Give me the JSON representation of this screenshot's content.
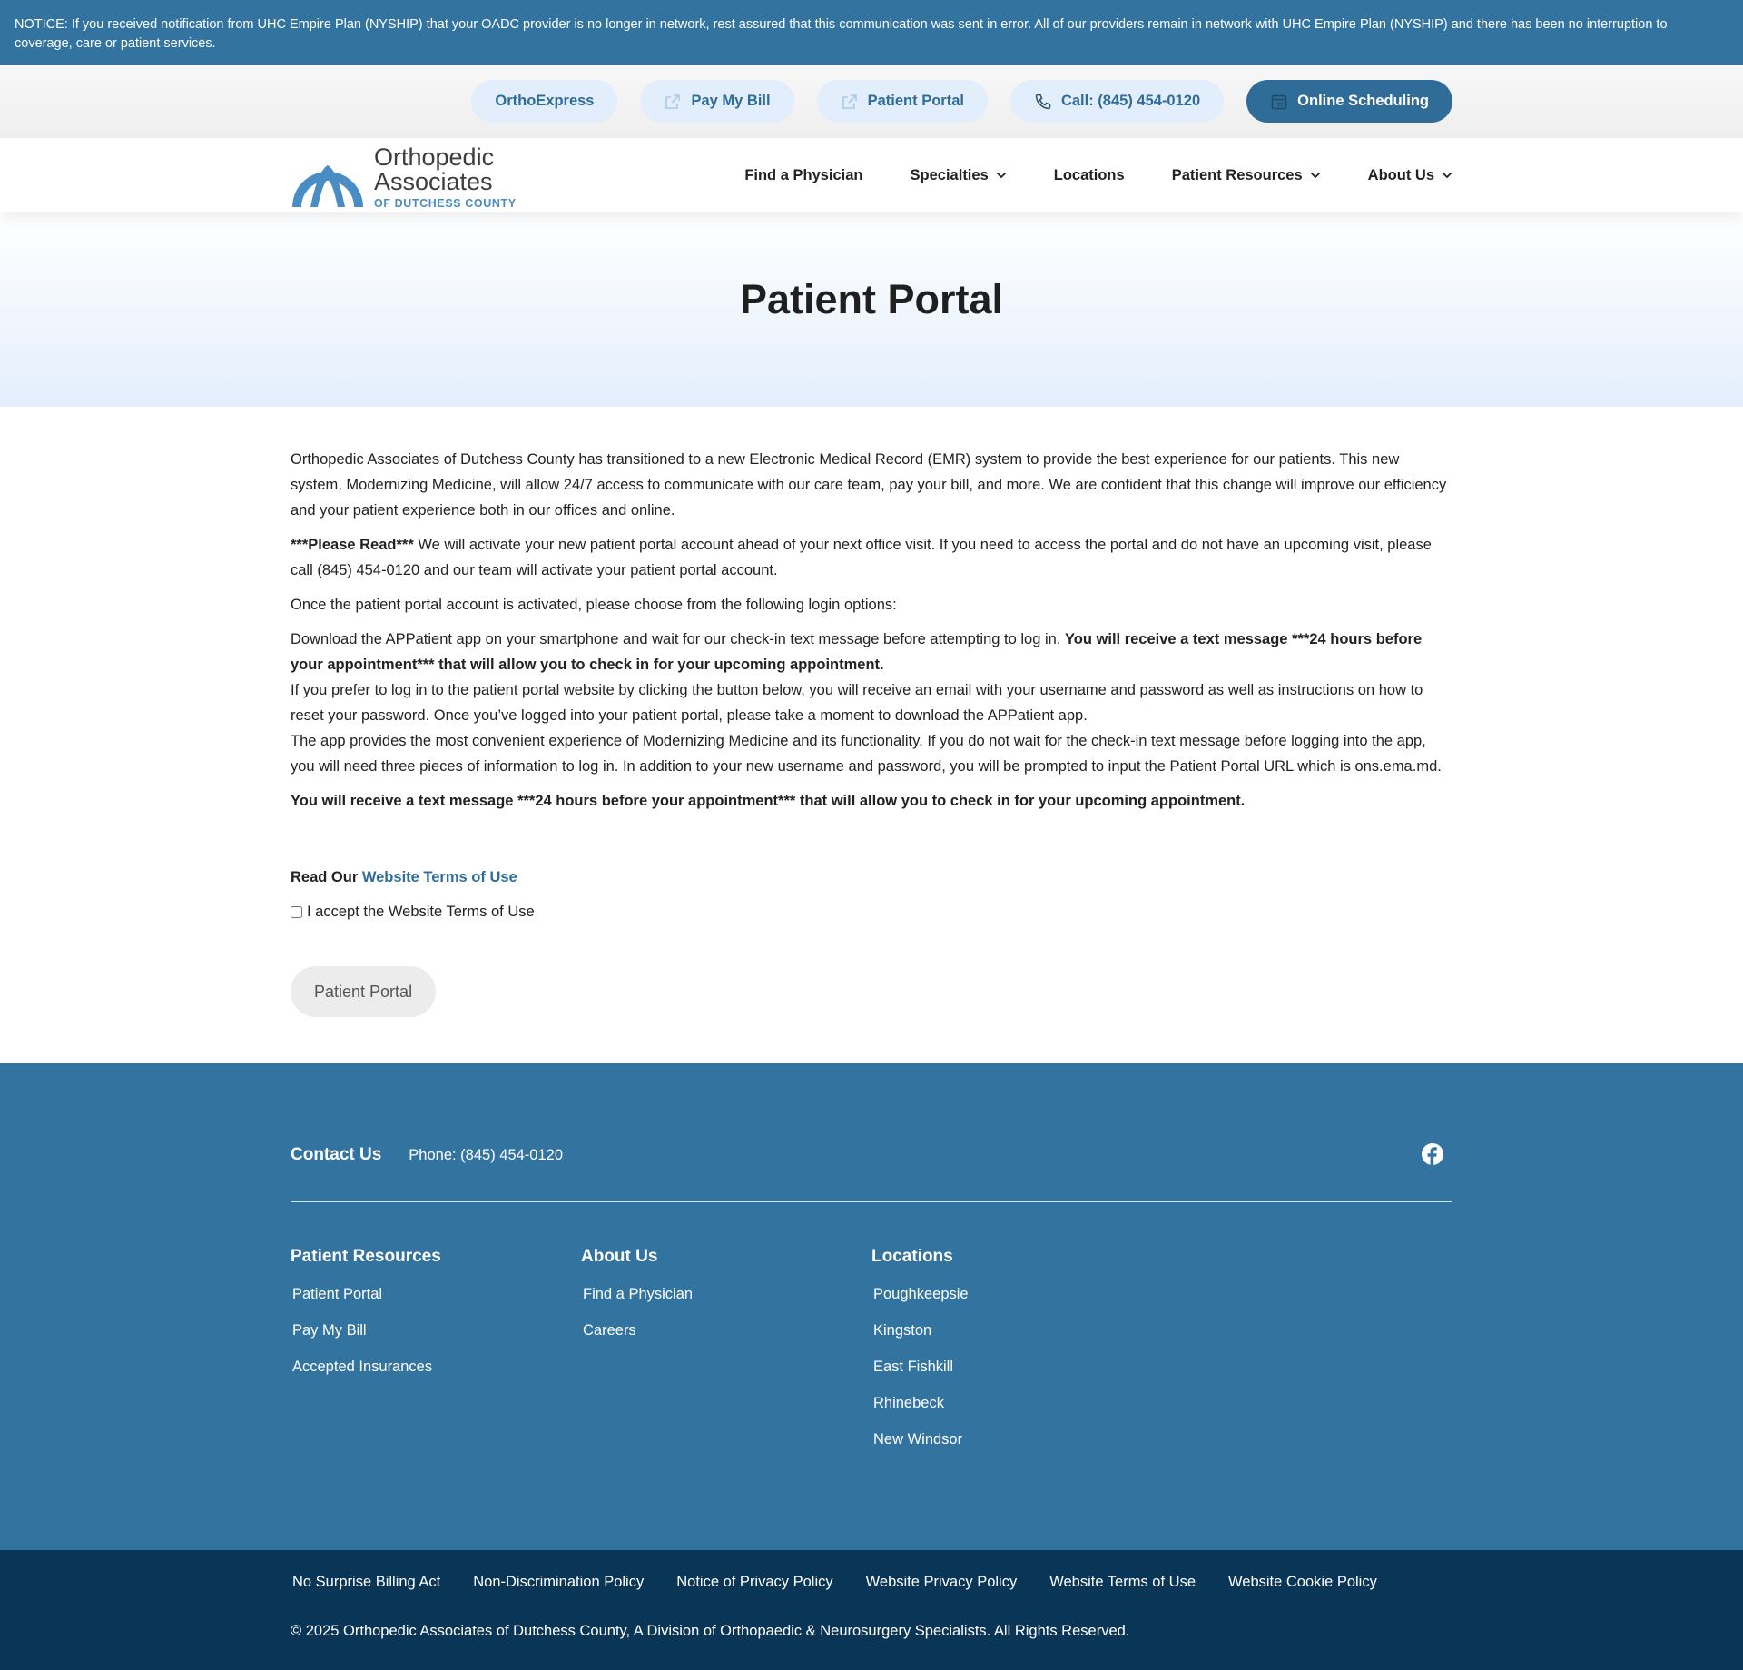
{
  "notice": "NOTICE: If you received notification from UHC Empire Plan (NYSHIP) that your OADC provider is no longer in network, rest assured that this communication was sent in error. All of our providers remain in network with UHC Empire Plan (NYSHIP) and there has been no interruption to coverage, care or patient services.",
  "utility": {
    "orthoexpress": "OrthoExpress",
    "pay_bill": "Pay My Bill",
    "patient_portal": "Patient Portal",
    "call": "Call: (845) 454-0120",
    "online_scheduling": "Online Scheduling"
  },
  "logo": {
    "line1": "Orthopedic",
    "line2": "Associates",
    "sub": "OF DUTCHESS COUNTY"
  },
  "nav": {
    "find_physician": "Find a Physician",
    "specialties": "Specialties",
    "locations": "Locations",
    "patient_resources": "Patient Resources",
    "about_us": "About Us"
  },
  "hero": {
    "title": "Patient Portal"
  },
  "content": {
    "p1": "Orthopedic Associates of Dutchess County has transitioned to a new Electronic Medical Record (EMR) system to provide the best experience for our patients. This new system, Modernizing Medicine, will allow 24/7 access to communicate with our care team, pay your bill, and more. We are confident that this change will improve our efficiency and your patient experience both in our offices and online.",
    "p2_bold": "***Please Read***",
    "p2_rest": " We will activate your new patient portal account ahead of your next office visit. If you need to access the portal and do not have an upcoming visit, please call (845) 454-0120 and our team will activate your patient portal account.",
    "p3": "Once the patient portal account is activated, please choose from the following login options:",
    "p4_plain": "Download the APPatient app on your smartphone and wait for our check-in text message before attempting to log in. ",
    "p4_bold": "You will receive a text message ***24 hours before your appointment*** that will allow you to check in for your upcoming appointment.",
    "p5": "If you prefer to log in to the patient portal website by clicking the button below, you will receive an email with your username and password as well as instructions on how to reset your password. Once you’ve logged into your patient portal, please take a moment to download the APPatient app.",
    "p6": "The app provides the most convenient experience of Modernizing Medicine and its functionality. If you do not wait for the check-in text message before logging into the app, you will need three pieces of information to log in. In addition to your new username and password, you will be prompted to input the Patient Portal URL which is ons.ema.md.",
    "p7": "You will receive a text message ***24 hours before your appointment*** that will allow you to check in for your upcoming appointment.",
    "terms_prefix": "Read Our ",
    "terms_link": "Website Terms of Use",
    "accept_label": "I accept the Website Terms of Use",
    "portal_button": "Patient Portal"
  },
  "footer": {
    "contact_title": "Contact Us",
    "phone": "Phone: (845) 454-0120",
    "columns": [
      {
        "title": "Patient Resources",
        "links": [
          "Patient Portal",
          "Pay My Bill",
          "Accepted Insurances"
        ]
      },
      {
        "title": "About Us",
        "links": [
          "Find a Physician",
          "Careers"
        ]
      },
      {
        "title": "Locations",
        "links": [
          "Poughkeepsie",
          "Kingston",
          "East Fishkill",
          "Rhinebeck",
          "New Windsor"
        ]
      }
    ]
  },
  "legal": {
    "links": [
      "No Surprise Billing Act",
      "Non-Discrimination Policy",
      "Notice of Privacy Policy",
      "Website Privacy Policy",
      "Website Terms of Use",
      "Website Cookie Policy"
    ],
    "copyright": "© 2025 Orthopedic Associates of Dutchess County, A Division of Orthopaedic & Neurosurgery Specialists. All Rights Reserved."
  },
  "colors": {
    "brand_blue": "#33739f",
    "button_blue": "#2f6d98",
    "pill_bg": "#e2eefb",
    "dark_footer": "#093656",
    "logo_blue": "#4a8cc4"
  },
  "icons": [
    "external-link-icon",
    "phone-icon",
    "calendar-icon",
    "chevron-down-icon",
    "facebook-icon"
  ]
}
